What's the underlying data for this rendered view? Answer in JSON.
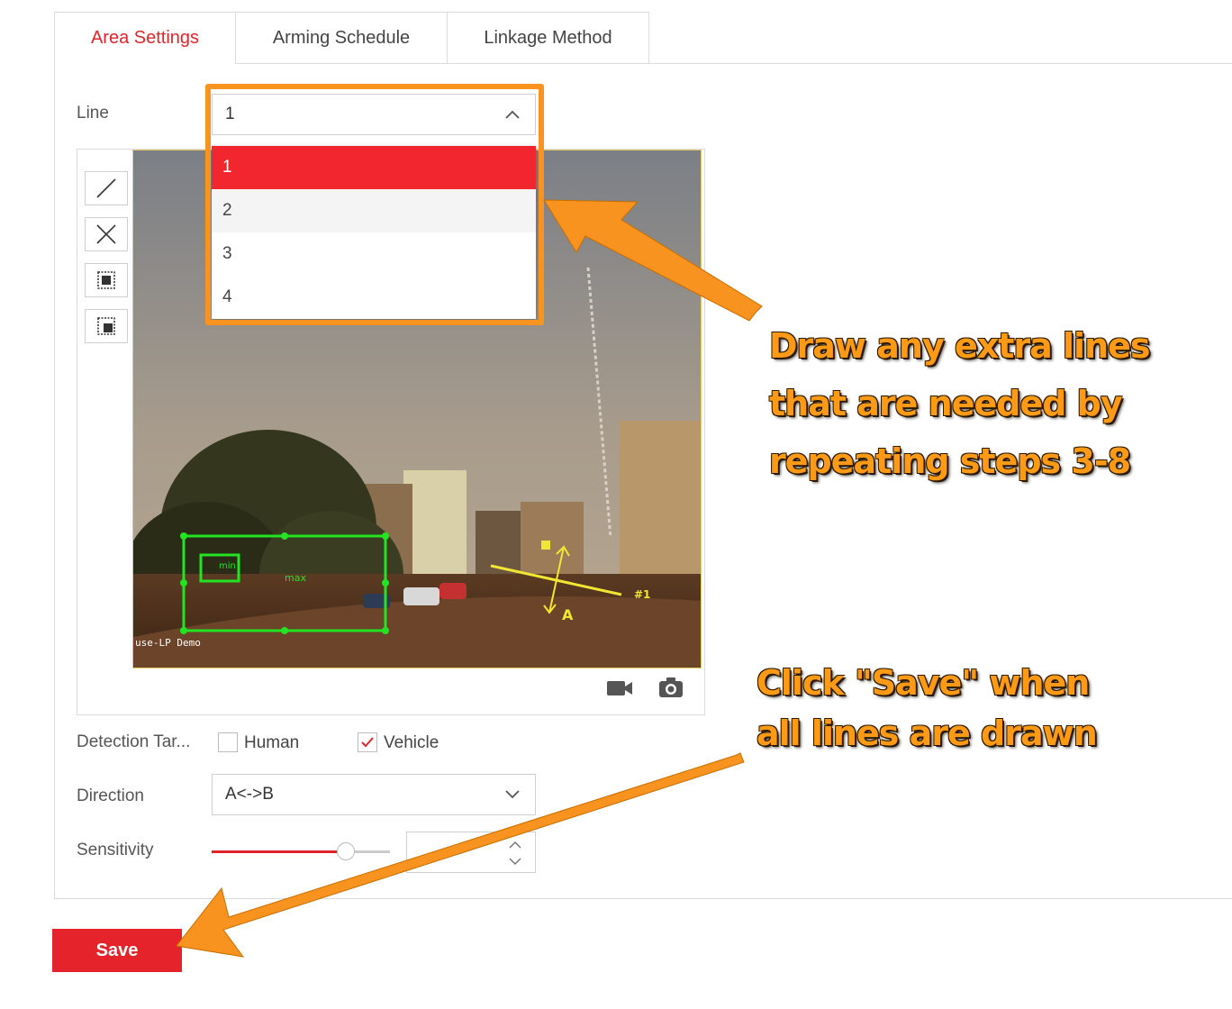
{
  "tabs": [
    {
      "label": "Area Settings",
      "active": true
    },
    {
      "label": "Arming Schedule",
      "active": false
    },
    {
      "label": "Linkage Method",
      "active": false
    }
  ],
  "line": {
    "label": "Line",
    "value": "1",
    "options": [
      "1",
      "2",
      "3",
      "4"
    ],
    "selected_index": 0,
    "hover_index": 1
  },
  "drawing_tools": [
    "draw-line-icon",
    "clear-icon",
    "min-size-icon",
    "max-size-icon"
  ],
  "video": {
    "osd_text": "use-LP Demo",
    "line_tag": "#1",
    "min_label": "min",
    "max_label": "max",
    "direction_marker": "A",
    "record_icon": "video-camera-icon",
    "capture_icon": "camera-icon"
  },
  "detection_target": {
    "label": "Detection Tar...",
    "options": [
      {
        "label": "Human",
        "checked": false
      },
      {
        "label": "Vehicle",
        "checked": true
      }
    ]
  },
  "direction": {
    "label": "Direction",
    "value": "A<->B"
  },
  "sensitivity": {
    "label": "Sensitivity",
    "value_fraction": 0.75
  },
  "save_label": "Save",
  "annotations": {
    "callout_1": [
      "Draw any extra lines",
      "that are needed by",
      "repeating steps 3-8"
    ],
    "callout_2": [
      "Click \"Save\" when",
      "all lines are drawn"
    ],
    "arrow_color": "#f7931e"
  },
  "colors": {
    "accent": "#e5232b",
    "highlight": "#f7931e",
    "overlay_green": "#22e422"
  }
}
